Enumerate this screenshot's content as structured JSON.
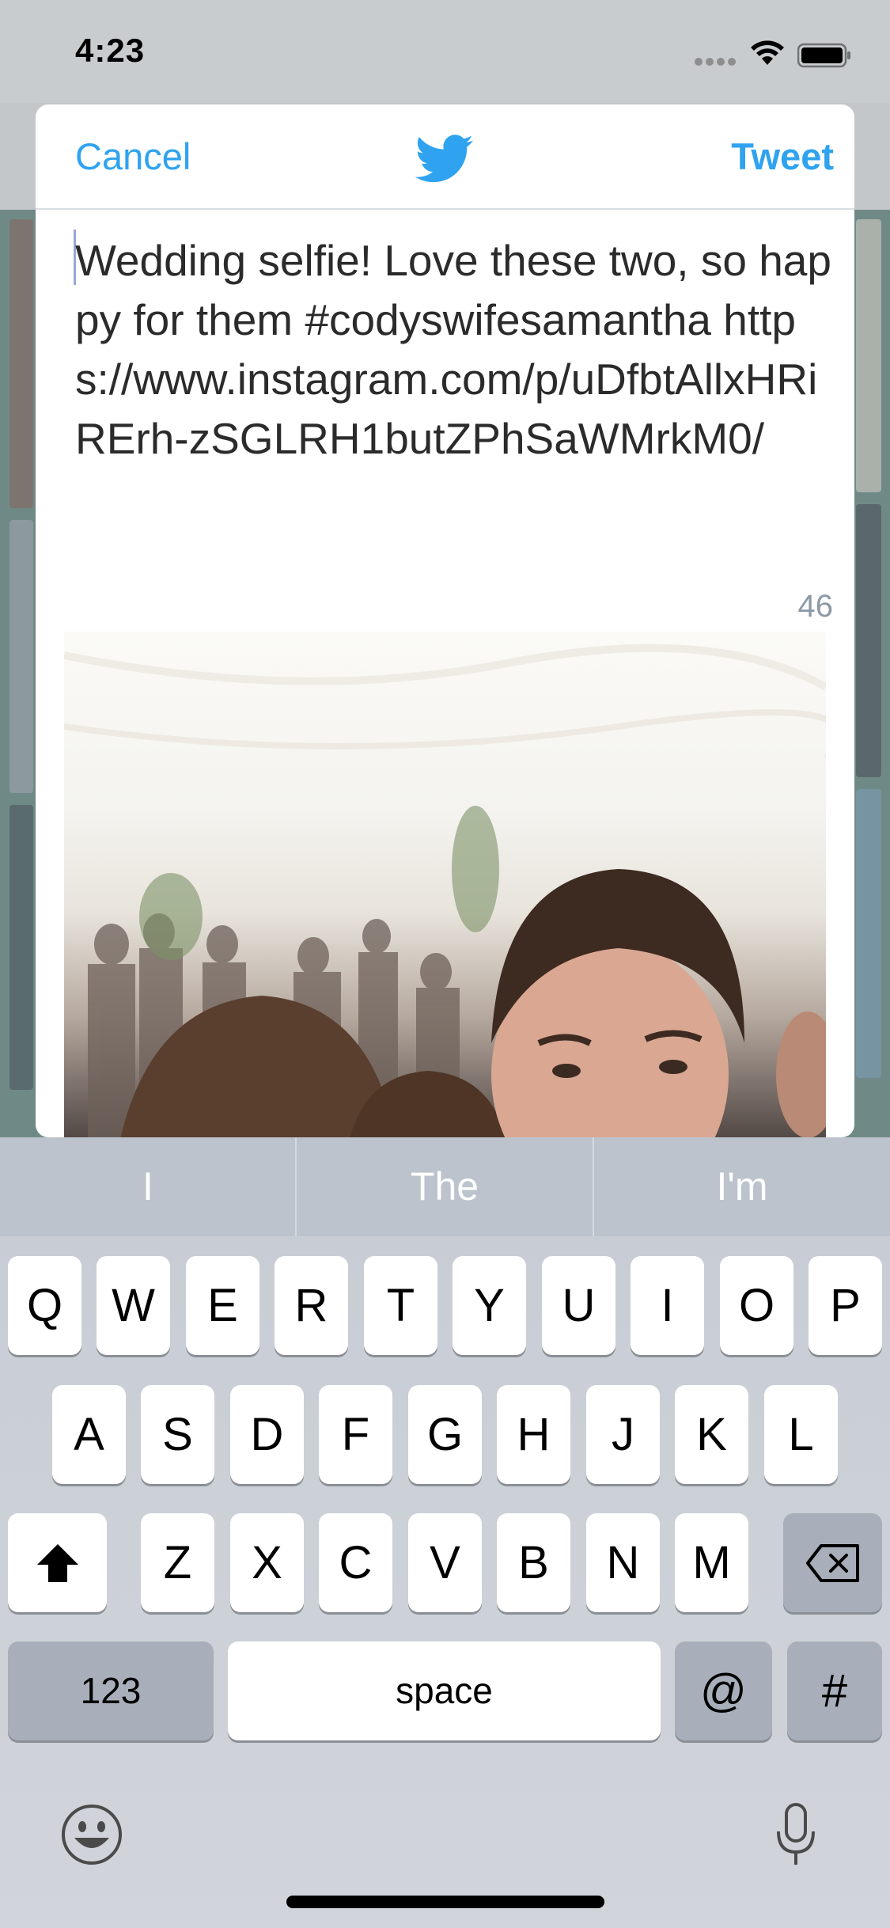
{
  "status_bar": {
    "time": "4:23"
  },
  "compose": {
    "cancel_label": "Cancel",
    "tweet_label": "Tweet",
    "logo_icon": "twitter-bird-icon",
    "text": "Wedding selfie! Love these two, so happy for them #codyswifesamantha https://www.instagram.com/p/uDfbtAllxHRiRErh-zSGLRH1butZPhSaWMrkM0/",
    "char_count": "46",
    "accent_color": "#2fa3ef"
  },
  "keyboard": {
    "suggestions": [
      "I",
      "The",
      "I'm"
    ],
    "row1": [
      "Q",
      "W",
      "E",
      "R",
      "T",
      "Y",
      "U",
      "I",
      "O",
      "P"
    ],
    "row2": [
      "A",
      "S",
      "D",
      "F",
      "G",
      "H",
      "J",
      "K",
      "L"
    ],
    "row3": [
      "Z",
      "X",
      "C",
      "V",
      "B",
      "N",
      "M"
    ],
    "numbers_label": "123",
    "space_label": "space",
    "at_label": "@",
    "hash_label": "#",
    "icons": [
      "shift-icon",
      "backspace-icon",
      "emoji-icon",
      "microphone-icon"
    ]
  }
}
